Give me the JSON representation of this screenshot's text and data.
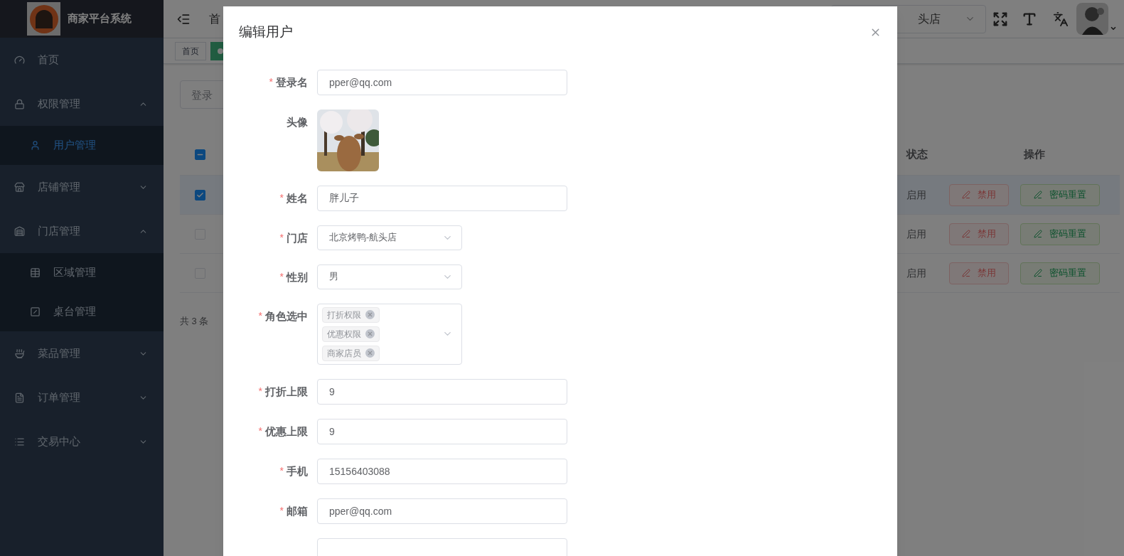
{
  "sidebar": {
    "title": "商家平台系统",
    "items": [
      {
        "label": "首页"
      },
      {
        "label": "权限管理",
        "expanded": true,
        "children": [
          {
            "label": "用户管理",
            "selected": true
          }
        ]
      },
      {
        "label": "店铺管理",
        "expanded": false
      },
      {
        "label": "门店管理",
        "expanded": true,
        "children": [
          {
            "label": "区域管理",
            "selected": false
          },
          {
            "label": "桌台管理",
            "selected": false
          }
        ]
      },
      {
        "label": "菜品管理",
        "expanded": false
      },
      {
        "label": "订单管理",
        "expanded": false
      },
      {
        "label": "交易中心",
        "expanded": false
      }
    ]
  },
  "header": {
    "breadcrumb": "首",
    "store_select": {
      "value": "头店"
    }
  },
  "tags": [
    {
      "label": "首页",
      "selected": false
    },
    {
      "selected": true
    }
  ],
  "search": {
    "placeholder": "登录"
  },
  "table": {
    "select_all": {
      "indeterminate": true
    },
    "columns": [
      "状态",
      "操作"
    ],
    "rows": [
      {
        "selected": true,
        "status": "启用",
        "actions": [
          "禁用",
          "密码重置"
        ]
      },
      {
        "selected": false,
        "status": "启用",
        "actions": [
          "禁用",
          "密码重置"
        ]
      },
      {
        "selected": false,
        "status": "启用",
        "actions": [
          "禁用",
          "密码重置"
        ]
      }
    ]
  },
  "pagination": {
    "total": "共 3 条"
  },
  "dialog": {
    "title": "编辑用户",
    "fields": [
      {
        "kind": "text",
        "required_mark": "*",
        "label": "登录名",
        "value": "pper@qq.com"
      },
      {
        "kind": "avatar",
        "label": "头像"
      },
      {
        "kind": "text",
        "required_mark": "*",
        "label": "姓名",
        "value": "胖儿子"
      },
      {
        "kind": "select",
        "required_mark": "*",
        "label": "门店",
        "value": "北京烤鸭-航头店"
      },
      {
        "kind": "select",
        "required_mark": "*",
        "label": "性别",
        "value": "男"
      },
      {
        "kind": "tags",
        "required_mark": "*",
        "label": "角色选中",
        "tags": [
          "打折权限",
          "优惠权限",
          "商家店员"
        ]
      },
      {
        "kind": "text",
        "required_mark": "*",
        "label": "打折上限",
        "value": "9"
      },
      {
        "kind": "text",
        "required_mark": "*",
        "label": "优惠上限",
        "value": "9"
      },
      {
        "kind": "text",
        "required_mark": "*",
        "label": "手机",
        "value": "15156403088"
      },
      {
        "kind": "text",
        "required_mark": "*",
        "label": "邮箱",
        "value": "pper@qq.com"
      },
      {
        "kind": "text"
      }
    ]
  }
}
